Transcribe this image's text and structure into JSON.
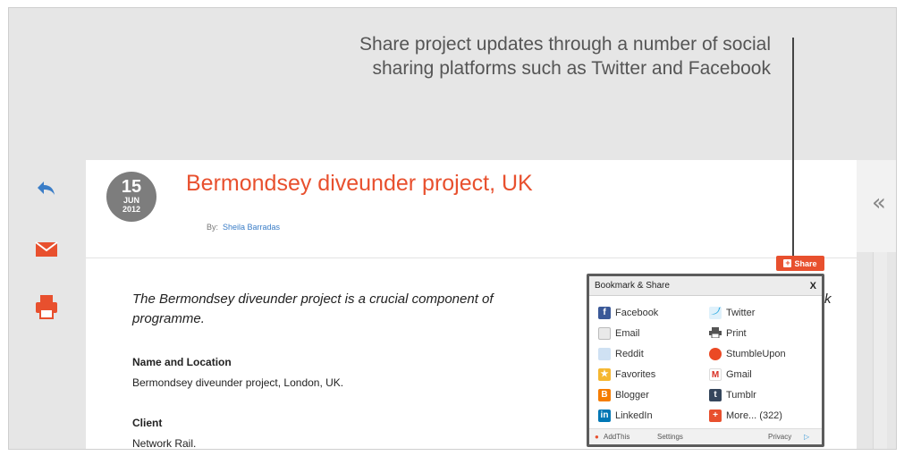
{
  "callout": {
    "line1": "Share project updates through a number of social",
    "line2": "sharing platforms such as Twitter and Facebook"
  },
  "rail": {
    "icons": [
      "reply-icon",
      "email-icon",
      "print-icon"
    ]
  },
  "post": {
    "date_day": "15",
    "date_month": "JUN",
    "date_year": "2012",
    "title": "Bermondsey diveunder project, UK",
    "by_label": "By:",
    "author": "Sheila Barradas",
    "lead_line1": "The Bermondsey diveunder project is a crucial component of",
    "lead_line1_tail": "k",
    "lead_line2": "programme.",
    "sections": [
      {
        "label": "Name and Location",
        "value": "Bermondsey diveunder project, London, UK."
      },
      {
        "label": "Client",
        "value": "Network Rail."
      }
    ]
  },
  "collapse_label": "«",
  "share_button": {
    "label": "Share"
  },
  "bookmark": {
    "title": "Bookmark & Share",
    "close": "X",
    "items_left": [
      "Facebook",
      "Email",
      "Reddit",
      "Favorites",
      "Blogger",
      "LinkedIn"
    ],
    "items_right": [
      "Twitter",
      "Print",
      "StumbleUpon",
      "Gmail",
      "Tumblr",
      "More... (322)"
    ],
    "footer": {
      "brand": "AddThis",
      "settings": "Settings",
      "privacy": "Privacy"
    }
  },
  "colors": {
    "accent": "#e8502e",
    "link": "#3a7dc7",
    "badge": "#7d7d7d"
  }
}
